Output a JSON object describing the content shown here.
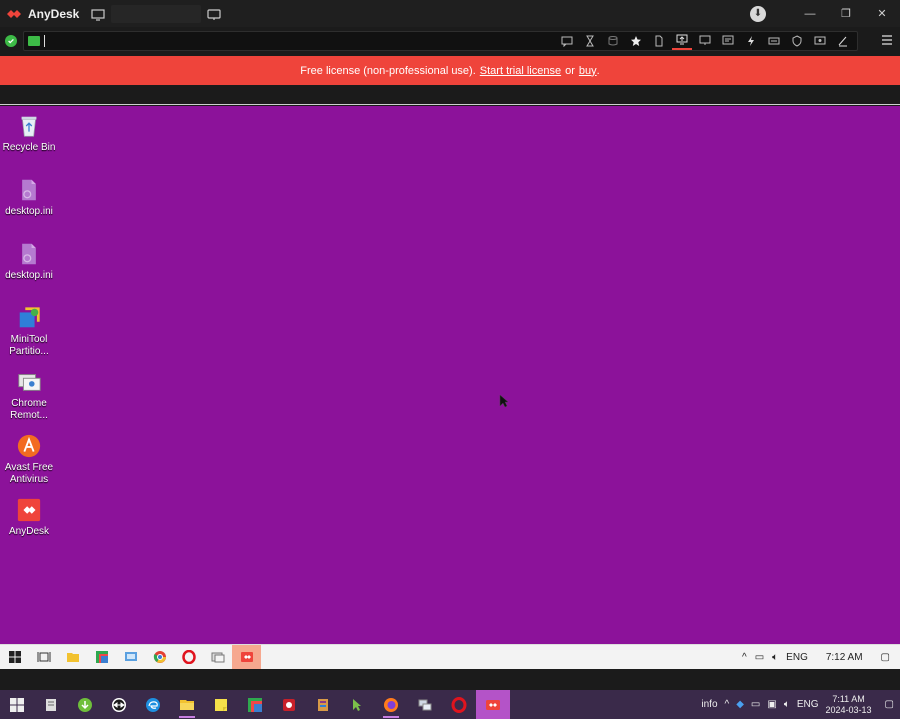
{
  "titlebar": {
    "app_name": "AnyDesk",
    "buttons": {
      "minimize": "—",
      "restore": "❐",
      "close": "✕"
    }
  },
  "banner": {
    "text_before": "Free license (non-professional use).",
    "trial_link": "Start trial license",
    "text_or": "or",
    "buy_link": "buy",
    "text_end": "."
  },
  "desktop": {
    "icons": [
      {
        "label": "Recycle Bin",
        "icon": "recycle-bin-icon"
      },
      {
        "label": "desktop.ini",
        "icon": "file-icon"
      },
      {
        "label": "desktop.ini",
        "icon": "file-icon"
      },
      {
        "label": "MiniTool Partitio...",
        "icon": "minitool-icon"
      },
      {
        "label": "Chrome Remot...",
        "icon": "chrome-remote-icon"
      },
      {
        "label": "Avast Free Antivirus",
        "icon": "avast-icon"
      },
      {
        "label": "AnyDesk",
        "icon": "anydesk-icon"
      }
    ],
    "background_color": "#8c129a"
  },
  "remote_taskbar": {
    "lang": "ENG",
    "time": "7:12 AM"
  },
  "local_taskbar": {
    "info_label": "info",
    "lang": "ENG",
    "time": "7:11 AM",
    "date": "2024-03-13"
  },
  "colors": {
    "accent": "#ef443b",
    "status_green": "#3dbb47"
  }
}
